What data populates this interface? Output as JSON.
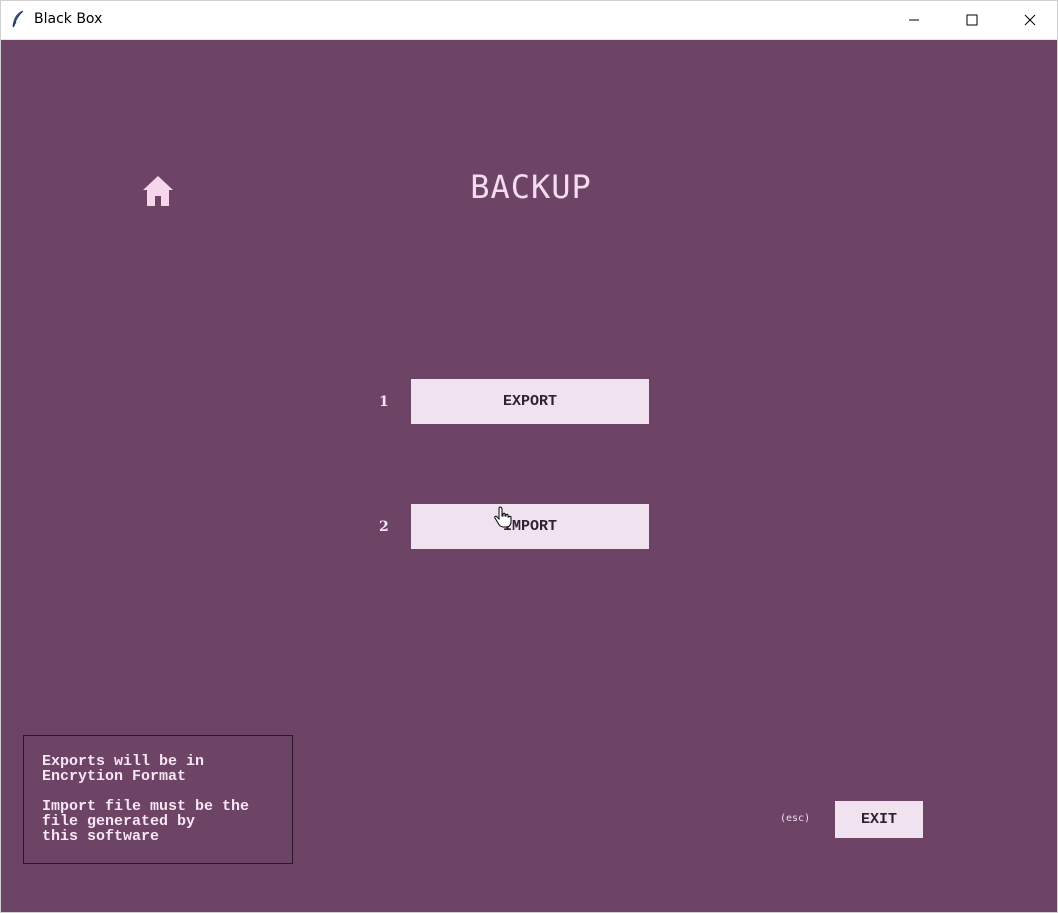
{
  "window": {
    "title": "Black Box",
    "app_icon": "feather-icon",
    "controls": [
      "minimize-icon",
      "maximize-icon",
      "close-icon"
    ]
  },
  "page": {
    "title": "BACKUP",
    "home_icon": "home-icon"
  },
  "menu": [
    {
      "number": "1",
      "label": "EXPORT"
    },
    {
      "number": "2",
      "label": "IMPORT"
    }
  ],
  "info": {
    "line1": "Exports will be in\nEncrytion Format",
    "line2": "Import file must be the\nfile generated by\nthis software"
  },
  "footer": {
    "esc_hint": "(esc)",
    "exit_label": "EXIT"
  },
  "colors": {
    "background": "#6d4465",
    "button_bg": "#f1e2ef",
    "button_text": "#2d2430",
    "text_light": "#f3dcef",
    "home_icon": "#f6d6ec"
  }
}
